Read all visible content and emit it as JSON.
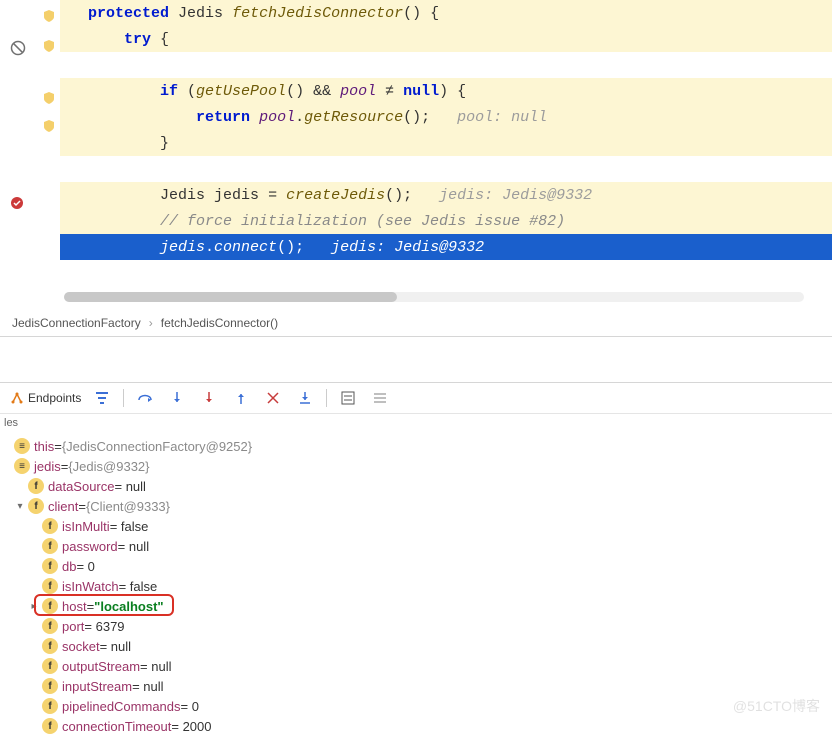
{
  "editor": {
    "lines": {
      "l1": {
        "kw1": "protected",
        "type": "Jedis",
        "method": "fetchJedisConnector",
        "p": "() {"
      },
      "l2": {
        "kw": "try",
        "p": " {"
      },
      "l3": {
        "kw": "if",
        "p1": " (",
        "m1": "getUsePool",
        "p2": "() && ",
        "id": "pool",
        "p3": " ≠ ",
        "kw2": "null",
        "p4": ") {"
      },
      "l4": {
        "kw": "return",
        "id": "pool",
        "p1": ".",
        "m": "getResource",
        "p2": "();",
        "dbg": "pool: null"
      },
      "l5": {
        "p": "}"
      },
      "l6": {
        "type": "Jedis",
        "var": "jedis",
        "eq": " = ",
        "m": "createJedis",
        "p": "();",
        "dbg": "jedis: Jedis@9332"
      },
      "l7": {
        "cmt": "// force initialization (see Jedis issue #82)"
      },
      "l8": {
        "id": "jedis",
        "dot": ".",
        "m": "connect",
        "p": "();",
        "dbg": "jedis: Jedis@9332"
      }
    }
  },
  "breadcrumb": {
    "a": "JedisConnectionFactory",
    "b": "fetchJedisConnector()"
  },
  "toolbar": {
    "endpoints": "Endpoints"
  },
  "sub": {
    "label": "les"
  },
  "vars": {
    "this_name": "this",
    "this_val": "{JedisConnectionFactory@9252}",
    "jedis_name": "jedis",
    "jedis_val": "{Jedis@9332}",
    "datasrc_name": "dataSource",
    "datasrc_val": " = null",
    "client_name": "client",
    "client_val": "{Client@9333}",
    "isInMulti_name": "isInMulti",
    "isInMulti_val": " = false",
    "password_name": "password",
    "password_val": " = null",
    "db_name": "db",
    "db_val": " = 0",
    "isInWatch_name": "isInWatch",
    "isInWatch_val": " = false",
    "host_name": "host",
    "host_eq": " = ",
    "host_val": "\"localhost\"",
    "port_name": "port",
    "port_val": " = 6379",
    "socket_name": "socket",
    "socket_val": " = null",
    "outs_name": "outputStream",
    "outs_val": " = null",
    "ins_name": "inputStream",
    "ins_val": " = null",
    "pipe_name": "pipelinedCommands",
    "pipe_val": " = 0",
    "ct_name": "connectionTimeout",
    "ct_val": " = 2000"
  },
  "watermark": "@51CTO博客"
}
